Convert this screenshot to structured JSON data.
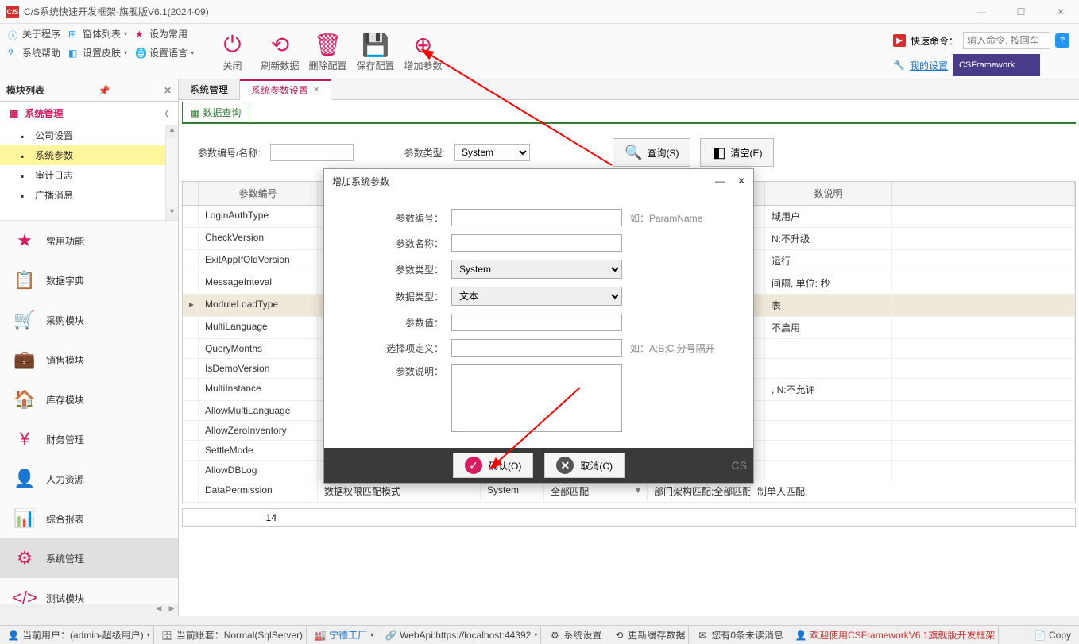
{
  "window": {
    "title": "C/S系统快速开发框架-旗舰版V6.1(2024-09)",
    "app_icon_text": "C/S"
  },
  "topmenu": {
    "row1": {
      "about": "关于程序",
      "windows": "窗体列表",
      "set_default": "设为常用"
    },
    "row2": {
      "syshelp": "系统帮助",
      "skin": "设置皮肤",
      "lang": "设置语言"
    },
    "buttons": {
      "close": "关闭",
      "refresh": "刷新数据",
      "delete": "删除配置",
      "save": "保存配置",
      "add": "增加参数"
    },
    "quickcmd_label": "快速命令：",
    "quickcmd_placeholder": "输入命令, 按回车",
    "my_settings": "我的设置",
    "csframework": "CSFramework"
  },
  "sidebar": {
    "header": "模块列表",
    "section_sysman": "系统管理",
    "tree": [
      {
        "label": "公司设置"
      },
      {
        "label": "系统参数"
      },
      {
        "label": "审计日志"
      },
      {
        "label": "广播消息"
      }
    ],
    "modules": [
      {
        "label": "常用功能",
        "icon": "★"
      },
      {
        "label": "数据字典",
        "icon": "📋"
      },
      {
        "label": "采购模块",
        "icon": "🛒"
      },
      {
        "label": "销售模块",
        "icon": "💼"
      },
      {
        "label": "库存模块",
        "icon": "🏠"
      },
      {
        "label": "财务管理",
        "icon": "¥"
      },
      {
        "label": "人力资源",
        "icon": "👤"
      },
      {
        "label": "综合报表",
        "icon": "📊"
      },
      {
        "label": "系统管理",
        "icon": "⚙"
      },
      {
        "label": "测试模块",
        "icon": "</>"
      }
    ]
  },
  "tabs": [
    {
      "label": "系统管理"
    },
    {
      "label": "系统参数设置"
    }
  ],
  "subtab": "数据查询",
  "search": {
    "code_label": "参数编号/名称:",
    "type_label": "参数类型:",
    "type_value": "System",
    "query_btn": "查询(S)",
    "clear_btn": "清空(E)"
  },
  "grid": {
    "headers": {
      "code": "参数编号",
      "desc": "数说明"
    },
    "rows": [
      {
        "code": "LoginAuthType",
        "desc": "域用户"
      },
      {
        "code": "CheckVersion",
        "desc": "N:不升级"
      },
      {
        "code": "ExitAppIfOldVersion",
        "desc": "运行"
      },
      {
        "code": "MessageInteval",
        "desc": "间隔, 单位: 秒"
      },
      {
        "code": "ModuleLoadType",
        "desc": "表"
      },
      {
        "code": "MultiLanguage",
        "desc": "不启用"
      },
      {
        "code": "QueryMonths",
        "desc": ""
      },
      {
        "code": "IsDemoVersion",
        "desc": ""
      },
      {
        "code": "MultiInstance",
        "desc": ", N:不允许"
      },
      {
        "code": "AllowMultiLanguage",
        "desc": ""
      },
      {
        "code": "AllowZeroInventory",
        "desc": ""
      },
      {
        "code": "SettleMode",
        "desc": ""
      },
      {
        "code": "AllowDBLog",
        "desc": ""
      },
      {
        "code": "DataPermission",
        "name": "数据权限匹配模式",
        "type": "System",
        "val": "全部匹配",
        "opt": "部门架构匹配;全部匹配",
        "extra": "制单人匹配;"
      }
    ],
    "count": "14"
  },
  "modal": {
    "title": "增加系统参数",
    "fields": {
      "code": "参数编号：",
      "code_hint": "如：ParamName",
      "name": "参数名称：",
      "type": "参数类型：",
      "type_val": "System",
      "datatype": "数据类型：",
      "datatype_val": "文本",
      "value": "参数值：",
      "options": "选择项定义：",
      "options_hint": "如：A;B;C 分号隔开",
      "desc": "参数说明："
    },
    "ok": "确认(O)",
    "cancel": "取消(C)",
    "logo": "CS"
  },
  "statusbar": {
    "user": "当前用户：(admin-超级用户)",
    "account": "当前账套：Normal(SqlServer)",
    "factory": "宁德工厂",
    "webapi": "WebApi:https://localhost:44392",
    "syssetting": "系统设置",
    "refresh_cache": "更新缓存数据",
    "unread": "您有0条未读消息",
    "welcome": "欢迎使用CSFrameworkV6.1旗舰版开发框架",
    "copy": "Copy"
  }
}
